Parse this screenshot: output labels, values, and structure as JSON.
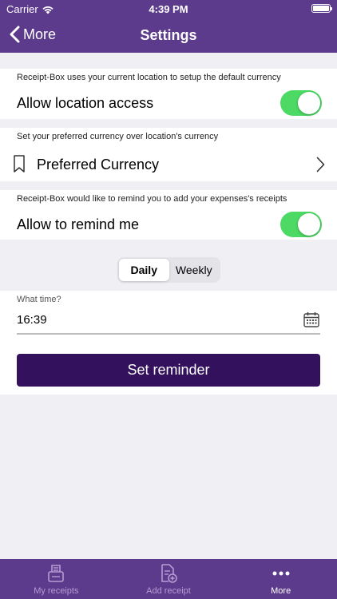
{
  "status_bar": {
    "carrier": "Carrier",
    "time": "4:39 PM"
  },
  "nav": {
    "back_label": "More",
    "title": "Settings"
  },
  "location": {
    "hint": "Receipt-Box uses your current location to setup the default currency",
    "label": "Allow location access",
    "enabled": true
  },
  "currency": {
    "hint": "Set your preferred currency over location's currency",
    "label": "Preferred Currency",
    "icon": "bookmark-icon"
  },
  "reminder": {
    "hint": "Receipt-Box would like to remind you to add your expenses's receipts",
    "label": "Allow to remind me",
    "enabled": true,
    "frequency_options": [
      "Daily",
      "Weekly"
    ],
    "selected_frequency": "Daily",
    "time_label": "What time?",
    "time_value": "16:39",
    "button_label": "Set reminder"
  },
  "tabs": [
    {
      "label": "My receipts",
      "icon": "receipts-icon",
      "active": false
    },
    {
      "label": "Add receipt",
      "icon": "add-receipt-icon",
      "active": false
    },
    {
      "label": "More",
      "icon": "more-icon",
      "active": true
    }
  ],
  "colors": {
    "brand": "#5c3a8c",
    "button": "#33115c",
    "toggle_on": "#4cd964"
  }
}
